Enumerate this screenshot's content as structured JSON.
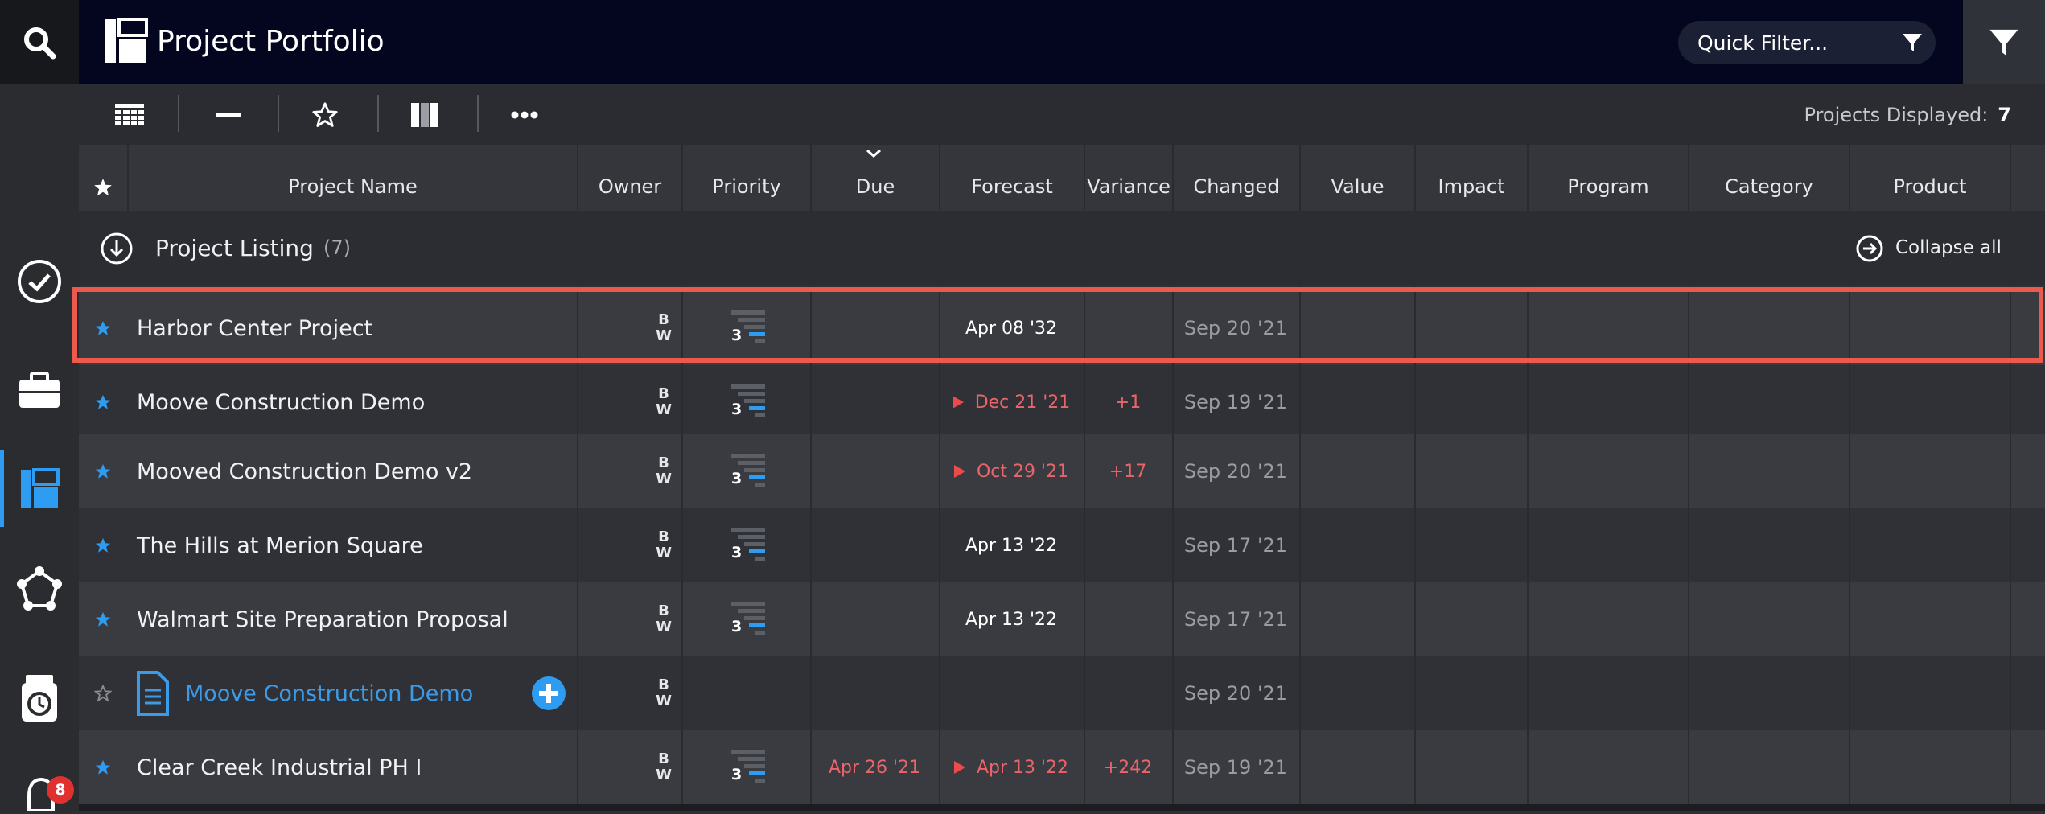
{
  "app": {
    "title": "Project Portfolio"
  },
  "header": {
    "quick_filter_placeholder": "Quick Filter..."
  },
  "toolbar": {
    "displayed_label": "Projects Displayed:",
    "displayed_count": "7"
  },
  "columns": [
    "Project Name",
    "Owner",
    "Priority",
    "Due",
    "Forecast",
    "Variance",
    "Changed",
    "Value",
    "Impact",
    "Program",
    "Category",
    "Product"
  ],
  "group": {
    "title": "Project Listing",
    "count": "(7)",
    "collapse_label": "Collapse all"
  },
  "rail": {
    "notification_count": "8"
  },
  "rows": [
    {
      "name": "Harbor Center Project",
      "starred": true,
      "owner": [
        "B",
        "W"
      ],
      "priority": "3",
      "due": "",
      "forecast": "Apr 08 '32",
      "forecast_late": false,
      "variance": "",
      "changed": "Sep 20 '21"
    },
    {
      "name": "Moove Construction Demo",
      "starred": true,
      "owner": [
        "B",
        "W"
      ],
      "priority": "3",
      "due": "",
      "forecast": "Dec 21 '21",
      "forecast_late": true,
      "variance": "+1",
      "changed": "Sep 19 '21"
    },
    {
      "name": "Mooved Construction Demo v2",
      "starred": true,
      "owner": [
        "B",
        "W"
      ],
      "priority": "3",
      "due": "",
      "forecast": "Oct 29 '21",
      "forecast_late": true,
      "variance": "+17",
      "changed": "Sep 20 '21"
    },
    {
      "name": "The Hills at Merion Square",
      "starred": true,
      "owner": [
        "B",
        "W"
      ],
      "priority": "3",
      "due": "",
      "forecast": "Apr 13 '22",
      "forecast_late": false,
      "variance": "",
      "changed": "Sep 17 '21"
    },
    {
      "name": "Walmart Site Preparation Proposal",
      "starred": true,
      "owner": [
        "B",
        "W"
      ],
      "priority": "3",
      "due": "",
      "forecast": "Apr 13 '22",
      "forecast_late": false,
      "variance": "",
      "changed": "Sep 17 '21"
    },
    {
      "name": "Moove Construction Demo",
      "starred": false,
      "is_template": true,
      "owner": [
        "B",
        "W"
      ],
      "priority": "",
      "due": "",
      "forecast": "",
      "forecast_late": false,
      "variance": "",
      "changed": "Sep 20 '21"
    },
    {
      "name": "Clear Creek Industrial PH I",
      "starred": true,
      "owner": [
        "B",
        "W"
      ],
      "priority": "3",
      "due": "Apr 26 '21",
      "forecast": "Apr 13 '22",
      "forecast_late": true,
      "variance": "+242",
      "changed": "Sep 19 '21"
    }
  ],
  "colors": {
    "accent": "#2e9cf0",
    "late": "#e9656a",
    "highlight": "#ec5a4d"
  }
}
